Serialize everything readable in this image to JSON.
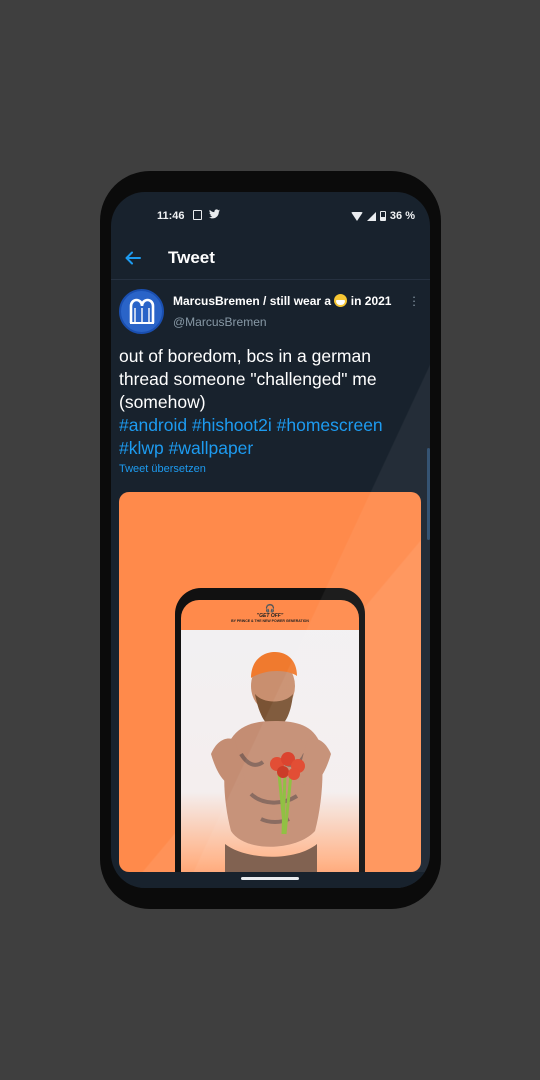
{
  "status": {
    "time": "11:46",
    "battery": "36 %"
  },
  "topbar": {
    "title": "Tweet"
  },
  "tweet": {
    "display_name": "MarcusBremen / still wear a",
    "display_name_suffix": "in 2021",
    "handle": "@MarcusBremen",
    "text": "out of boredom, bcs in a german thread someone \"challenged\" me (somehow)",
    "hashtags": "#android #hishoot2i #homescreen #klwp #wallpaper",
    "translate_label": "Tweet übersetzen"
  },
  "media": {
    "album_title": "\"GET OFF\"",
    "album_subtitle": "BY PRINCE & THE NEW POWER GENERATION"
  },
  "colors": {
    "background": "#3f3f3f",
    "screen": "#18222d",
    "accent": "#1d9bf0",
    "media_bg": "#ff8a4b"
  }
}
